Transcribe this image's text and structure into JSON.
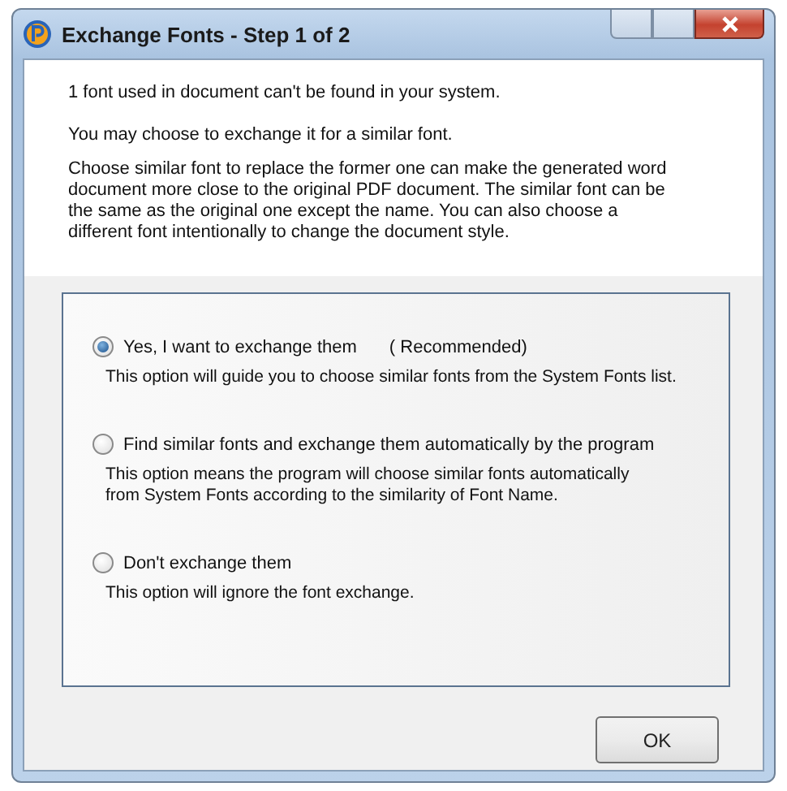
{
  "window": {
    "title": "Exchange Fonts - Step 1 of 2"
  },
  "intro": [
    "1 font used in document can't be found in your system.",
    "You may choose to exchange it for a similar font.",
    "Choose similar font to replace the former one can make the generated word document more close to the original PDF document. The similar font can be the same as the original one except the name. You can also choose a different font intentionally to change the document style."
  ],
  "options": [
    {
      "label": "Yes, I want to exchange them",
      "note": "( Recommended)",
      "description": "This option will guide you to choose similar fonts from the System Fonts list.",
      "selected": true
    },
    {
      "label": "Find similar fonts and exchange them automatically by the program",
      "description": "This option means the program will choose similar fonts automatically from System Fonts according to the similarity of Font Name.",
      "selected": false
    },
    {
      "label": "Don't exchange them",
      "description": "This option will ignore the font exchange.",
      "selected": false
    }
  ],
  "buttons": [
    "OK"
  ]
}
